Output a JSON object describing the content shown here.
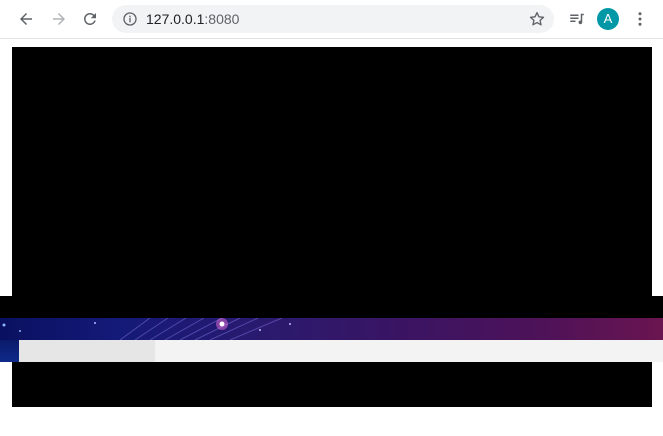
{
  "browser": {
    "url_host": "127.0.0.1",
    "url_port": ":8080",
    "profile_initial": "A"
  },
  "icons": {
    "back": "arrow-left",
    "forward": "arrow-right",
    "reload": "reload",
    "info": "info-circle",
    "bookmark": "star-outline",
    "media": "queue-music",
    "menu": "more-vertical"
  },
  "colors": {
    "avatar": "#0097a7",
    "banner_start": "#0a1060",
    "banner_end": "#6a1550"
  }
}
